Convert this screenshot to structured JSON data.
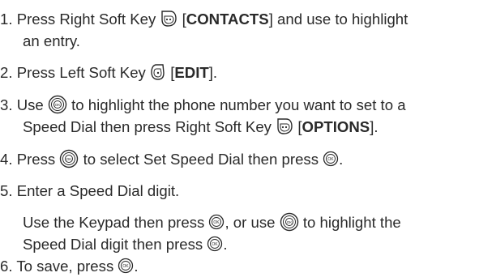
{
  "steps": [
    {
      "number": "1.",
      "lines": [
        {
          "pre": "Press Right Soft Key",
          "key": "CONTACTS",
          "post": "and use to highlight"
        },
        {
          "text": "an entry."
        }
      ]
    },
    {
      "number": "2.",
      "lines": [
        {
          "pre": "Press Left Soft Key",
          "key": "EDIT",
          "post": "."
        }
      ]
    },
    {
      "number": "3.",
      "lines": [
        {
          "pre": "Use",
          "post": "to highlight the phone number you want to set to a"
        },
        {
          "pre": "Speed Dial then press Right Soft Key",
          "key": "OPTIONS",
          "post": "."
        }
      ]
    },
    {
      "number": "4.",
      "lines": [
        {
          "pre": "Press",
          "mid": "to select Set Speed Dial then press",
          "post": "."
        }
      ]
    },
    {
      "number": "5.",
      "lines": [
        {
          "text": "Enter a Speed Dial digit."
        },
        {
          "pre": "Use the Keypad then press",
          "mid": ", or use",
          "post": "to highlight the"
        },
        {
          "pre": "Speed Dial digit then press",
          "post": "."
        }
      ]
    },
    {
      "number": "6.",
      "lines": [
        {
          "pre": "To save, press",
          "post": "."
        }
      ]
    }
  ],
  "icons": {
    "right_soft_key": "right-soft-key-icon",
    "left_soft_key": "left-soft-key-icon",
    "navigation_key": "navigation-key-icon",
    "ok_key": "ok-key-icon"
  }
}
